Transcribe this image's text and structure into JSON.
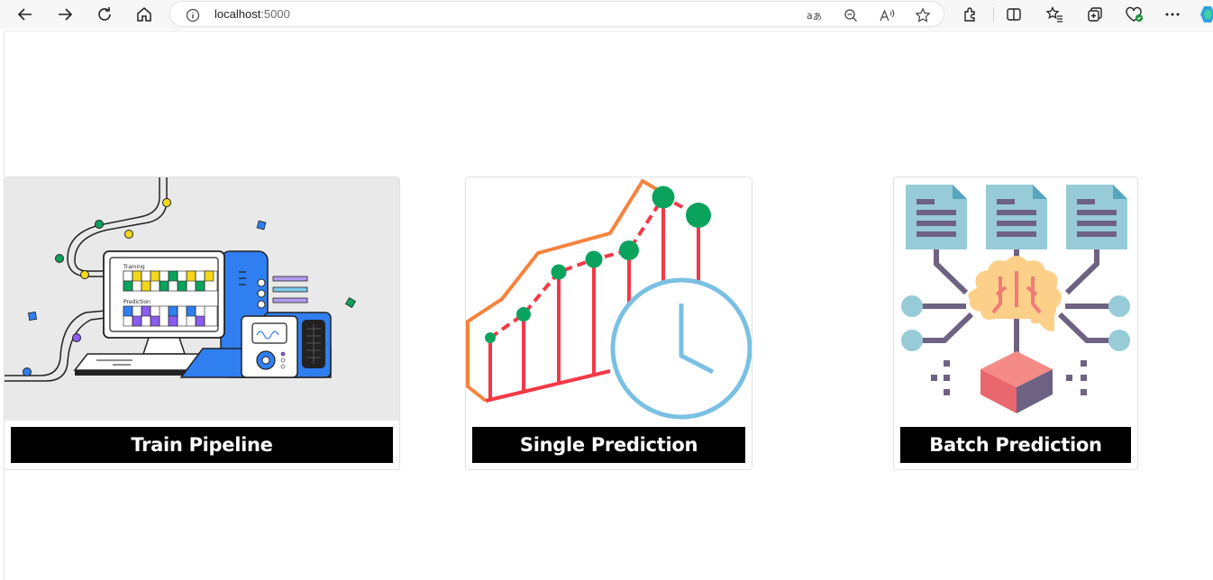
{
  "browser": {
    "url_host": "localhost",
    "url_port": ":5000"
  },
  "cards": [
    {
      "label": "Train Pipeline"
    },
    {
      "label": "Single Prediction"
    },
    {
      "label": "Batch Prediction"
    }
  ],
  "illustration": {
    "screen_row1": "Training",
    "screen_row2": "Prediction"
  },
  "colors": {
    "button_bg": "#000000",
    "button_text": "#ffffff",
    "clock": "#7ac0e4",
    "dots": "#0aa35d",
    "bars": "#f43847",
    "line": "#f5833e",
    "machine": "#2f7ff1"
  }
}
